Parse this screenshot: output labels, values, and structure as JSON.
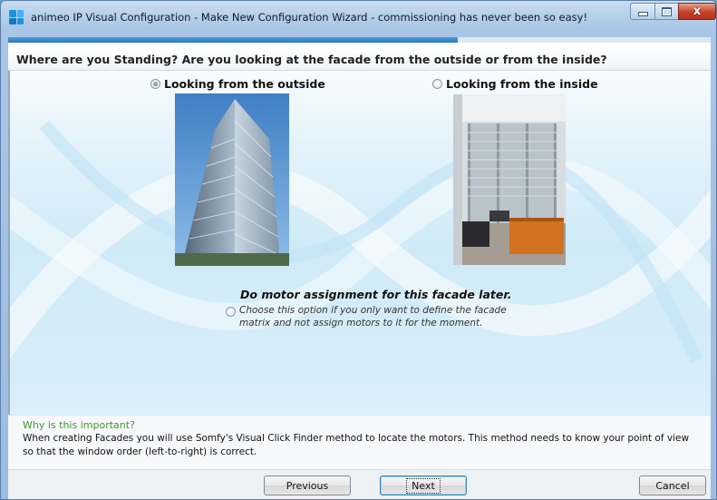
{
  "window": {
    "title": "animeo IP Visual Configuration - Make New Configuration Wizard - commissioning has never been so easy!",
    "close_glyph": "x"
  },
  "progress": {
    "value_fraction": 0.64
  },
  "header": {
    "question": "Where are you Standing? Are you looking at the facade from the outside or from the inside?"
  },
  "options": {
    "outside": {
      "label": "Looking from the outside",
      "selected": true
    },
    "inside": {
      "label": "Looking from the inside",
      "selected": false
    }
  },
  "later": {
    "title": "Do motor assignment for this facade later.",
    "description": "Choose this option if you only want to define the facade matrix and not assign motors to it for the moment.",
    "selected": false
  },
  "why": {
    "title": "Why is this important?",
    "text": "When creating Facades you will use Somfy's Visual Click Finder method to locate the motors. This method needs to know your point of view so that the window order (left-to-right) is correct."
  },
  "buttons": {
    "previous": "Previous",
    "next": "Next",
    "cancel": "Cancel"
  },
  "colors": {
    "accent": "#2a78c0",
    "why_title": "#3b9a2a"
  }
}
